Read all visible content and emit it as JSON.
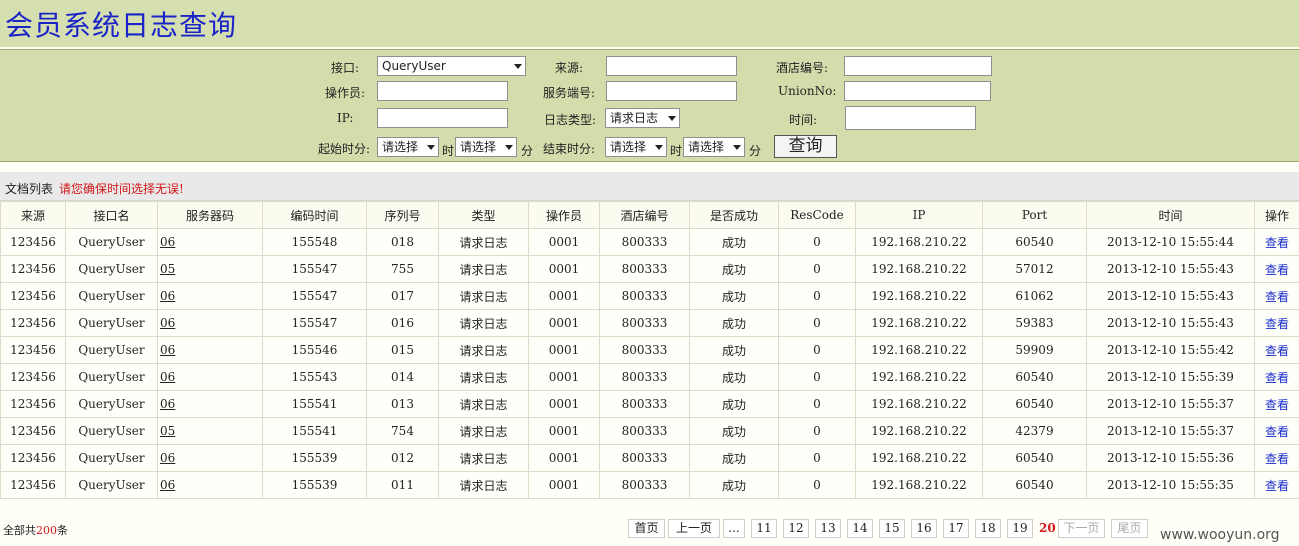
{
  "page": {
    "title": "会员系统日志查询"
  },
  "search": {
    "interface_label": "接口:",
    "interface_value": "QueryUser",
    "source_label": "来源:",
    "source_value": "",
    "hotel_label": "酒店编号:",
    "hotel_value": "",
    "operator_label": "操作员:",
    "operator_value": "",
    "service_label": "服务端号:",
    "service_value": "",
    "unionno_label": "UnionNo:",
    "unionno_value": "",
    "ip_label": "IP:",
    "ip_value": "",
    "logtype_label": "日志类型:",
    "logtype_value": "请求日志",
    "time_label": "时间:",
    "time_value": "",
    "start_label": "起始时分:",
    "start_hour": "请选择",
    "start_min": "请选择",
    "end_label": "结束时分:",
    "end_hour": "请选择",
    "end_min": "请选择",
    "hour_word": "时",
    "min_word": "分",
    "query_button": "查询"
  },
  "list": {
    "label": "文档列表",
    "warning": "请您确保时间选择无误!"
  },
  "table": {
    "headers": [
      "来源",
      "接口名",
      "服务器码",
      "编码时间",
      "序列号",
      "类型",
      "操作员",
      "酒店编号",
      "是否成功",
      "ResCode",
      "IP",
      "Port",
      "时间",
      "操作"
    ],
    "rows": [
      [
        "123456",
        "QueryUser",
        "06",
        "155548",
        "018",
        "请求日志",
        "0001",
        "800333",
        "成功",
        "0",
        "192.168.210.22",
        "60540",
        "2013-12-10 15:55:44",
        "查看"
      ],
      [
        "123456",
        "QueryUser",
        "05",
        "155547",
        "755",
        "请求日志",
        "0001",
        "800333",
        "成功",
        "0",
        "192.168.210.22",
        "57012",
        "2013-12-10 15:55:43",
        "查看"
      ],
      [
        "123456",
        "QueryUser",
        "06",
        "155547",
        "017",
        "请求日志",
        "0001",
        "800333",
        "成功",
        "0",
        "192.168.210.22",
        "61062",
        "2013-12-10 15:55:43",
        "查看"
      ],
      [
        "123456",
        "QueryUser",
        "06",
        "155547",
        "016",
        "请求日志",
        "0001",
        "800333",
        "成功",
        "0",
        "192.168.210.22",
        "59383",
        "2013-12-10 15:55:43",
        "查看"
      ],
      [
        "123456",
        "QueryUser",
        "06",
        "155546",
        "015",
        "请求日志",
        "0001",
        "800333",
        "成功",
        "0",
        "192.168.210.22",
        "59909",
        "2013-12-10 15:55:42",
        "查看"
      ],
      [
        "123456",
        "QueryUser",
        "06",
        "155543",
        "014",
        "请求日志",
        "0001",
        "800333",
        "成功",
        "0",
        "192.168.210.22",
        "60540",
        "2013-12-10 15:55:39",
        "查看"
      ],
      [
        "123456",
        "QueryUser",
        "06",
        "155541",
        "013",
        "请求日志",
        "0001",
        "800333",
        "成功",
        "0",
        "192.168.210.22",
        "60540",
        "2013-12-10 15:55:37",
        "查看"
      ],
      [
        "123456",
        "QueryUser",
        "05",
        "155541",
        "754",
        "请求日志",
        "0001",
        "800333",
        "成功",
        "0",
        "192.168.210.22",
        "42379",
        "2013-12-10 15:55:37",
        "查看"
      ],
      [
        "123456",
        "QueryUser",
        "06",
        "155539",
        "012",
        "请求日志",
        "0001",
        "800333",
        "成功",
        "0",
        "192.168.210.22",
        "60540",
        "2013-12-10 15:55:36",
        "查看"
      ],
      [
        "123456",
        "QueryUser",
        "06",
        "155539",
        "011",
        "请求日志",
        "0001",
        "800333",
        "成功",
        "0",
        "192.168.210.22",
        "60540",
        "2013-12-10 15:55:35",
        "查看"
      ]
    ]
  },
  "footer": {
    "total_prefix": "全部共",
    "total_count": "200",
    "total_suffix": "条",
    "first": "首页",
    "prev": "上一页",
    "ellipsis": "...",
    "pages": [
      "11",
      "12",
      "13",
      "14",
      "15",
      "16",
      "17",
      "18",
      "19"
    ],
    "current": "20",
    "next": "下一页",
    "last": "尾页"
  },
  "watermark": "www.wooyun.org"
}
